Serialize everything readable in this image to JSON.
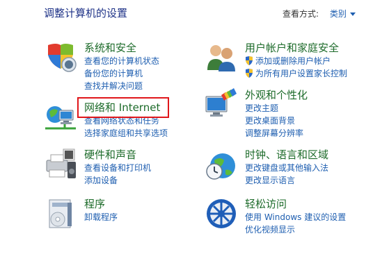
{
  "header": {
    "title": "调整计算机的设置",
    "view_by_label": "查看方式:",
    "view_by_value": "类别"
  },
  "categories": {
    "system": {
      "title": "系统和安全",
      "links": [
        "查看您的计算机状态",
        "备份您的计算机",
        "查找并解决问题"
      ]
    },
    "network": {
      "title": "网络和 Internet",
      "links": [
        "查看网络状态和任务",
        "选择家庭组和共享选项"
      ]
    },
    "hardware": {
      "title": "硬件和声音",
      "links": [
        "查看设备和打印机",
        "添加设备"
      ]
    },
    "programs": {
      "title": "程序",
      "links": [
        "卸载程序"
      ]
    },
    "users": {
      "title": "用户帐户和家庭安全",
      "links": [
        "添加或删除用户帐户",
        "为所有用户设置家长控制"
      ]
    },
    "appearance": {
      "title": "外观和个性化",
      "links": [
        "更改主题",
        "更改桌面背景",
        "调整屏幕分辨率"
      ]
    },
    "clock": {
      "title": "时钟、语言和区域",
      "links": [
        "更改键盘或其他输入法",
        "更改显示语言"
      ]
    },
    "ease": {
      "title": "轻松访问",
      "links": [
        "使用 Windows 建议的设置",
        "优化视频显示"
      ]
    }
  },
  "icons": {
    "system": "security-shield-icon",
    "network": "network-globe-icon",
    "hardware": "printer-icon",
    "programs": "programs-box-icon",
    "users": "users-icon",
    "appearance": "display-palette-icon",
    "clock": "clock-globe-icon",
    "ease": "ease-of-access-icon",
    "uac": "uac-shield-icon"
  },
  "colors": {
    "category_title": "#1d6b2a",
    "link": "#1e5eb0",
    "highlight_box": "#e0161b"
  }
}
